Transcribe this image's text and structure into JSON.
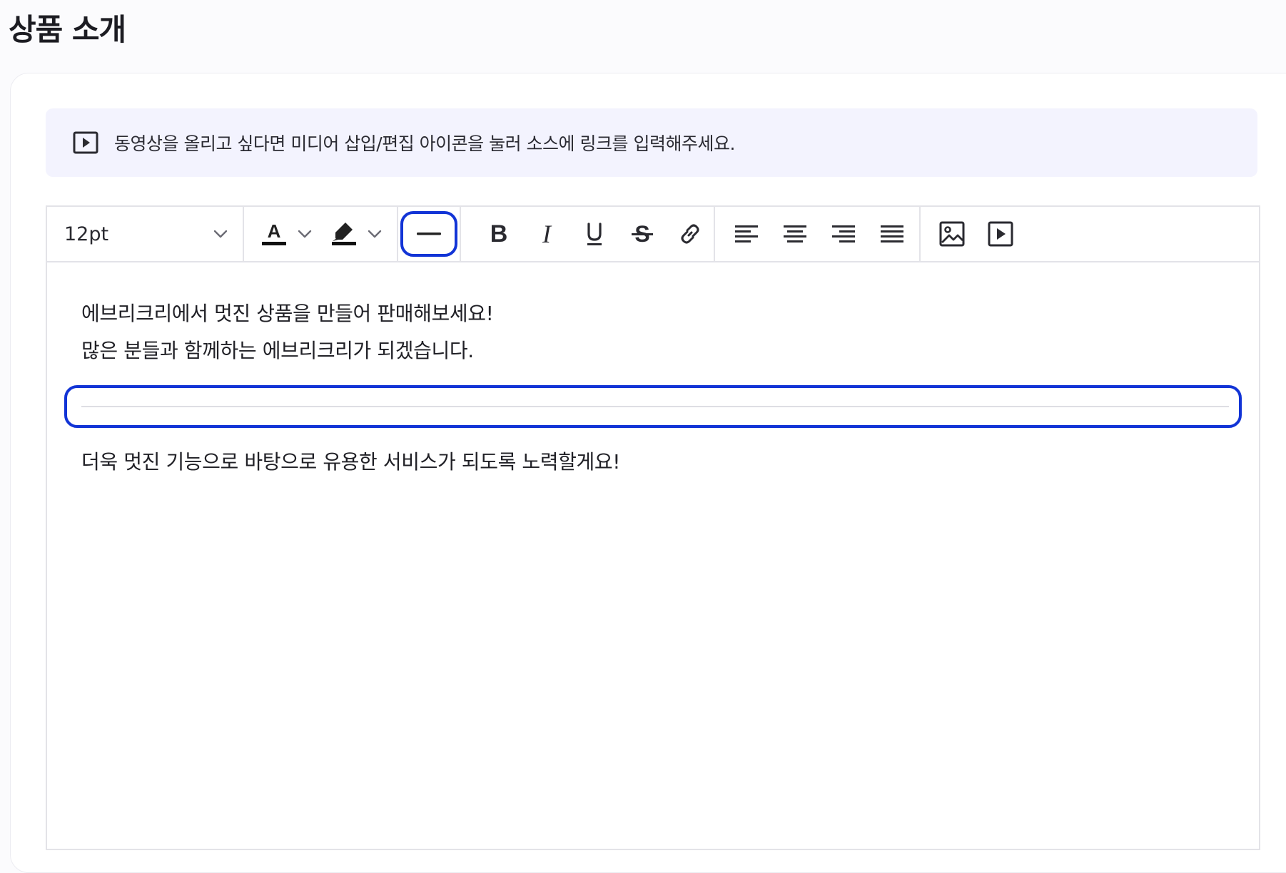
{
  "page": {
    "title": "상품 소개"
  },
  "notice": {
    "icon": "video-play-icon",
    "text": "동영상을 올리고 싶다면 미디어 삽입/편집 아이콘을 눌러 소스에 링크를 입력해주세요."
  },
  "toolbar": {
    "font_size": "12pt",
    "font_color": {
      "letter": "A",
      "icon": "font-color-icon",
      "swatch": "#111111"
    },
    "highlight": {
      "icon": "highlighter-icon",
      "swatch": "#111111"
    },
    "horizontal_rule": {
      "icon": "horizontal-rule-icon",
      "active": true,
      "accent": "#1234d6"
    },
    "format_buttons": [
      {
        "name": "bold",
        "icon": "bold-icon"
      },
      {
        "name": "italic",
        "icon": "italic-icon"
      },
      {
        "name": "underline",
        "icon": "underline-icon"
      },
      {
        "name": "strikethrough",
        "icon": "strikethrough-icon"
      },
      {
        "name": "link",
        "icon": "link-icon"
      }
    ],
    "align_buttons": [
      {
        "name": "align-left",
        "icon": "align-left-icon"
      },
      {
        "name": "align-center",
        "icon": "align-center-icon"
      },
      {
        "name": "align-right",
        "icon": "align-right-icon"
      },
      {
        "name": "align-justify",
        "icon": "align-justify-icon"
      }
    ],
    "media_buttons": [
      {
        "name": "insert-image",
        "icon": "image-icon"
      },
      {
        "name": "insert-video",
        "icon": "video-play-icon"
      }
    ]
  },
  "content": {
    "paragraphs": [
      "에브리크리에서 멋진 상품을 만들어 판매해보세요!",
      "많은 분들과 함께하는 에브리크리가 되겠습니다."
    ],
    "selected_block": "horizontal-rule",
    "after_rule": "더욱 멋진 기능으로 바탕으로  유용한 서비스가 되도록 노력할게요!"
  }
}
